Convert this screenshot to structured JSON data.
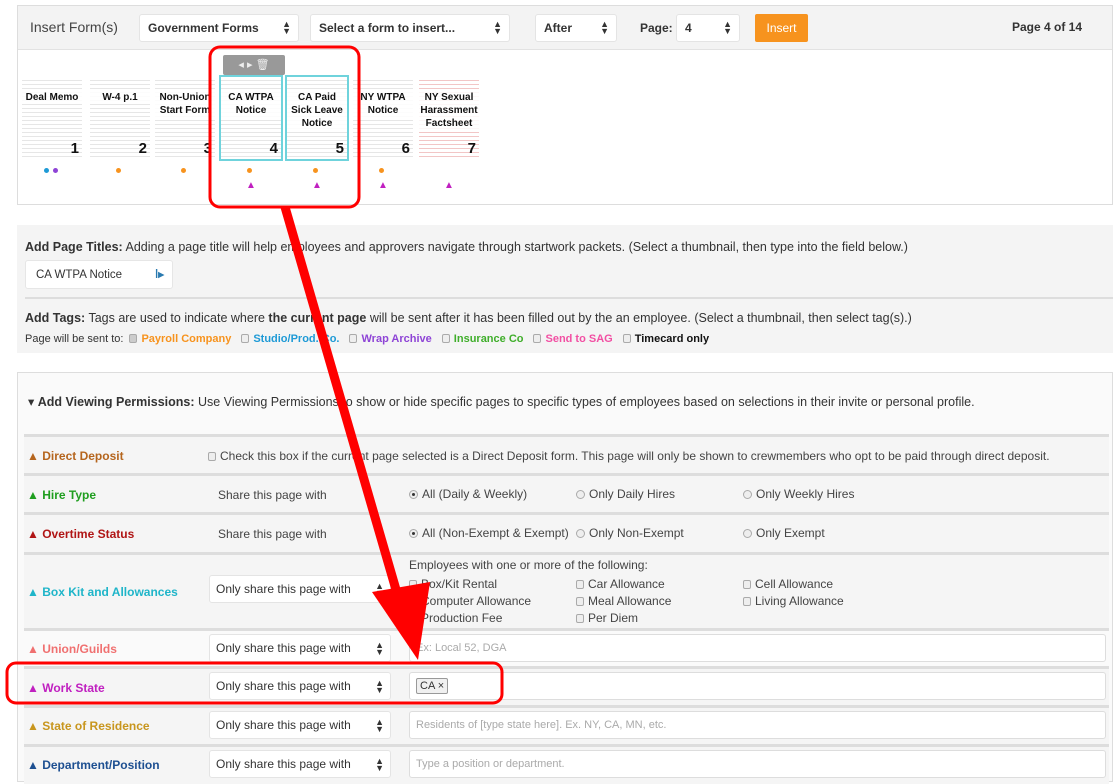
{
  "insert": {
    "title": "Insert Form(s)",
    "category": "Government Forms",
    "form_placeholder": "Select a form to insert...",
    "position": "After",
    "page_label": "Page:",
    "page_value": "4",
    "insert_button": "Insert",
    "page_indicator": "Page 4 of 14",
    "accent": "#f7931e"
  },
  "thumbnails": [
    {
      "title": "Deal Memo",
      "num": "1"
    },
    {
      "title": "W-4 p.1",
      "num": "2"
    },
    {
      "title": "Non-Union Start Form",
      "num": "3"
    },
    {
      "title": "CA WTPA Notice",
      "num": "4"
    },
    {
      "title": "CA Paid Sick Leave Notice",
      "num": "5"
    },
    {
      "title": "NY WTPA Notice",
      "num": "6"
    },
    {
      "title": "NY Sexual Harassment Factsheet",
      "num": "7"
    }
  ],
  "page_titles": {
    "label": "Add Page Titles:",
    "description": "Adding a page title will help employees and approvers navigate through startwork packets. (Select a thumbnail, then type into the field below.)",
    "value": "CA WTPA Notice"
  },
  "tags": {
    "label": "Add Tags:",
    "desc_1": "Tags are used to indicate where ",
    "desc_bold": "the current page",
    "desc_2": " will be sent after it has been filled out by the an employee. (Select a thumbnail, then select tag(s).)",
    "sent_to": "Page will be sent to:",
    "items": [
      {
        "label": "Payroll Company",
        "color": "#f7931e",
        "checked": true
      },
      {
        "label": "Studio/Prod. Co.",
        "color": "#1e9ad6",
        "checked": false
      },
      {
        "label": "Wrap Archive",
        "color": "#8e44d6",
        "checked": false
      },
      {
        "label": "Insurance Co",
        "color": "#3fae2a",
        "checked": false
      },
      {
        "label": "Send to SAG",
        "color": "#f24fa3",
        "checked": false
      },
      {
        "label": "Timecard only",
        "color": "#111111",
        "checked": false
      }
    ]
  },
  "permissions": {
    "label": "Add Viewing Permissions:",
    "description": "Use Viewing Permissions to show or hide specific pages to specific types of employees based on selections in their invite or personal profile.",
    "direct_deposit": {
      "label": "Direct Deposit",
      "color": "#b5651d",
      "text": "Check this box if the current page selected is a Direct Deposit form. This page will only be shown to crewmembers who opt to be paid through direct deposit."
    },
    "hire_type": {
      "label": "Hire Type",
      "color": "#1f9e1f",
      "share": "Share this page with",
      "options": [
        "All (Daily & Weekly)",
        "Only Daily Hires",
        "Only Weekly Hires"
      ]
    },
    "overtime": {
      "label": "Overtime Status",
      "color": "#b01515",
      "share": "Share this page with",
      "options": [
        "All (Non-Exempt & Exempt)",
        "Only Non-Exempt",
        "Only Exempt"
      ]
    },
    "box_kit": {
      "label": "Box Kit and Allowances",
      "color": "#1fb5c9",
      "select": "Only share this page with",
      "heading": "Employees with one or more of the following:",
      "options": [
        "Box/Kit Rental",
        "Car Allowance",
        "Cell Allowance",
        "Computer Allowance",
        "Meal Allowance",
        "Living Allowance",
        "Production Fee",
        "Per Diem"
      ]
    },
    "union": {
      "label": "Union/Guilds",
      "color": "#f07070",
      "select": "Only share this page with",
      "placeholder": "Ex: Local 52, DGA"
    },
    "work_state": {
      "label": "Work State",
      "color": "#c020c0",
      "select": "Only share this page with",
      "tag": "CA"
    },
    "residence": {
      "label": "State of Residence",
      "color": "#c8961e",
      "select": "Only share this page with",
      "placeholder": "Residents of [type state here]. Ex. NY, CA, MN, etc."
    },
    "department": {
      "label": "Department/Position",
      "color": "#1d4f91",
      "select": "Only share this page with",
      "placeholder": "Type a position or department."
    }
  },
  "annotation_color": "#ff0000"
}
